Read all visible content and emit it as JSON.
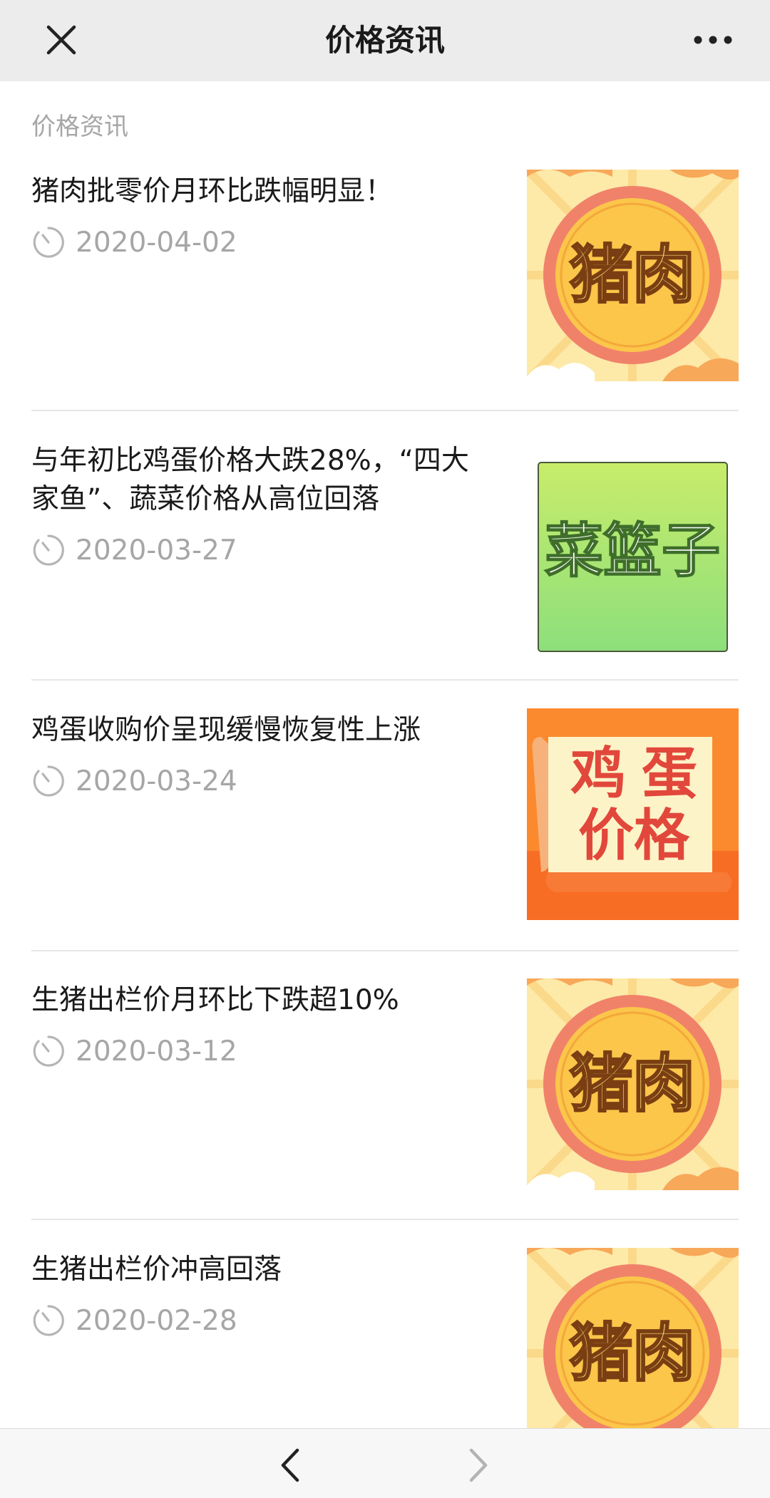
{
  "header": {
    "title": "价格资讯",
    "close_icon": "close-icon",
    "more_icon": "more-icon"
  },
  "section_label": "价格资讯",
  "articles": [
    {
      "title": "猪肉批零价月环比跌幅明显！",
      "date": "2020-04-02",
      "thumb_text": "猪肉",
      "thumb_type": "pork"
    },
    {
      "title": "与年初比鸡蛋价格大跌28%，“四大家鱼”、蔬菜价格从高位回落",
      "date": "2020-03-27",
      "thumb_text": "菜篮子",
      "thumb_type": "basket"
    },
    {
      "title": "鸡蛋收购价呈现缓慢恢复性上涨",
      "date": "2020-03-24",
      "thumb_text_line1": "鸡 蛋",
      "thumb_text_line2": "价格",
      "thumb_type": "egg"
    },
    {
      "title": "生猪出栏价月环比下跌超10%",
      "date": "2020-03-12",
      "thumb_text": "猪肉",
      "thumb_type": "pork"
    },
    {
      "title": "生猪出栏价冲高回落",
      "date": "2020-02-28",
      "thumb_text": "猪肉",
      "thumb_type": "pork"
    }
  ],
  "bottom_nav": {
    "back_icon": "chevron-left-icon",
    "forward_icon": "chevron-right-icon"
  },
  "colors": {
    "pork_ring": "#f0826a",
    "pork_center": "#fbc64a",
    "pork_bg": "#fde9a8",
    "basket_green_top": "#c8ec6a",
    "basket_green_bottom": "#8ddf7c",
    "egg_orange": "#fb8a2e",
    "egg_text": "#e2473b"
  }
}
